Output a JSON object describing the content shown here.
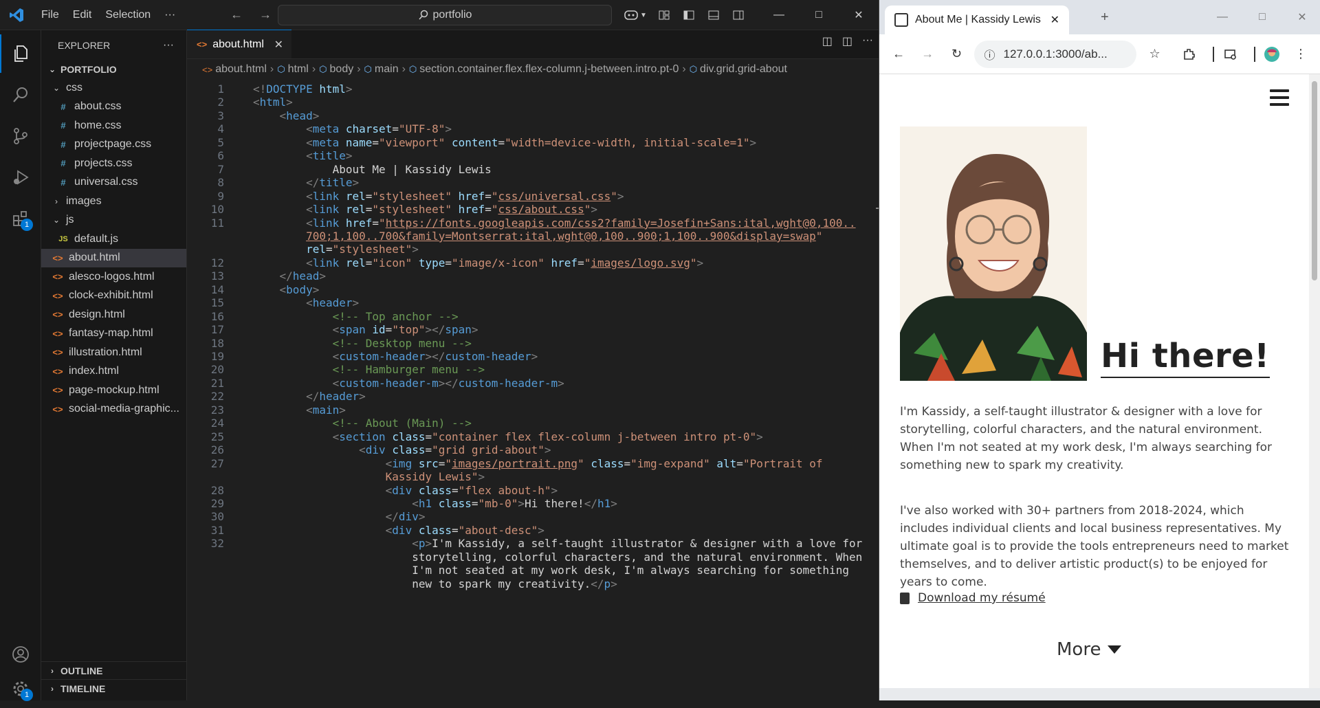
{
  "vscode": {
    "menu": [
      "File",
      "Edit",
      "Selection"
    ],
    "menu_more": "···",
    "command_center": "portfolio",
    "explorer_title": "EXPLORER",
    "explorer_more": "···",
    "root_folder": "PORTFOLIO",
    "tree": [
      {
        "label": "css",
        "kind": "folder",
        "expanded": true,
        "depth": 1
      },
      {
        "label": "about.css",
        "kind": "css",
        "depth": 2
      },
      {
        "label": "home.css",
        "kind": "css",
        "depth": 2
      },
      {
        "label": "projectpage.css",
        "kind": "css",
        "depth": 2
      },
      {
        "label": "projects.css",
        "kind": "css",
        "depth": 2
      },
      {
        "label": "universal.css",
        "kind": "css",
        "depth": 2
      },
      {
        "label": "images",
        "kind": "folder",
        "expanded": false,
        "depth": 1
      },
      {
        "label": "js",
        "kind": "folder",
        "expanded": true,
        "depth": 1
      },
      {
        "label": "default.js",
        "kind": "js",
        "depth": 2
      },
      {
        "label": "about.html",
        "kind": "html",
        "depth": 1,
        "selected": true
      },
      {
        "label": "alesco-logos.html",
        "kind": "html",
        "depth": 1
      },
      {
        "label": "clock-exhibit.html",
        "kind": "html",
        "depth": 1
      },
      {
        "label": "design.html",
        "kind": "html",
        "depth": 1
      },
      {
        "label": "fantasy-map.html",
        "kind": "html",
        "depth": 1
      },
      {
        "label": "illustration.html",
        "kind": "html",
        "depth": 1
      },
      {
        "label": "index.html",
        "kind": "html",
        "depth": 1
      },
      {
        "label": "page-mockup.html",
        "kind": "html",
        "depth": 1
      },
      {
        "label": "social-media-graphic...",
        "kind": "html",
        "depth": 1
      }
    ],
    "outline": "OUTLINE",
    "timeline": "TIMELINE",
    "extensions_badge": "1",
    "settings_badge": "1",
    "active_tab": "about.html",
    "breadcrumbs": [
      "about.html",
      "html",
      "body",
      "main",
      "section.container.flex.flex-column.j-between.intro.pt-0",
      "div.grid.grid-about"
    ],
    "code_lines": [
      {
        "n": "1",
        "html": "<span class='p'>&lt;!</span><span class='t'>DOCTYPE</span> <span class='a'>html</span><span class='p'>&gt;</span>"
      },
      {
        "n": "2",
        "html": "<span class='p'>&lt;</span><span class='t'>html</span><span class='p'>&gt;</span>"
      },
      {
        "n": "3",
        "html": "    <span class='p'>&lt;</span><span class='t'>head</span><span class='p'>&gt;</span>"
      },
      {
        "n": "4",
        "html": "        <span class='p'>&lt;</span><span class='t'>meta</span> <span class='a'>charset</span><span class='x'>=</span><span class='s'>\"UTF-8\"</span><span class='p'>&gt;</span>"
      },
      {
        "n": "5",
        "html": "        <span class='p'>&lt;</span><span class='t'>meta</span> <span class='a'>name</span><span class='x'>=</span><span class='s'>\"viewport\"</span> <span class='a'>content</span><span class='x'>=</span><span class='s'>\"width=device-width, initial-scale=1\"</span><span class='p'>&gt;</span>"
      },
      {
        "n": "6",
        "html": "        <span class='p'>&lt;</span><span class='t'>title</span><span class='p'>&gt;</span>"
      },
      {
        "n": "7",
        "html": "            <span class='x'>About Me | Kassidy Lewis</span>"
      },
      {
        "n": "8",
        "html": "        <span class='p'>&lt;/</span><span class='t'>title</span><span class='p'>&gt;</span>"
      },
      {
        "n": "9",
        "html": "        <span class='p'>&lt;</span><span class='t'>link</span> <span class='a'>rel</span><span class='x'>=</span><span class='s'>\"stylesheet\"</span> <span class='a'>href</span><span class='x'>=</span><span class='s'>\"</span><span class='u'>css/universal.css</span><span class='s'>\"</span><span class='p'>&gt;</span>"
      },
      {
        "n": "10",
        "html": "        <span class='p'>&lt;</span><span class='t'>link</span> <span class='a'>rel</span><span class='x'>=</span><span class='s'>\"stylesheet\"</span> <span class='a'>href</span><span class='x'>=</span><span class='s'>\"</span><span class='u'>css/about.css</span><span class='s'>\"</span><span class='p'>&gt;</span>"
      },
      {
        "n": "11",
        "html": "        <span class='p'>&lt;</span><span class='t'>link</span> <span class='a'>href</span><span class='x'>=</span><span class='s'>\"</span><span class='u'>https://fonts.googleapis.com/css2?family=Josefin+Sans:ital,wght@0,100..</span>"
      },
      {
        "n": "",
        "html": "        <span class='u'>700;1,100..700&amp;family=Montserrat:ital,wght@0,100..900;1,100..900&amp;display=swap</span><span class='s'>\"</span>"
      },
      {
        "n": "",
        "html": "        <span class='a'>rel</span><span class='x'>=</span><span class='s'>\"stylesheet\"</span><span class='p'>&gt;</span>"
      },
      {
        "n": "12",
        "html": "        <span class='p'>&lt;</span><span class='t'>link</span> <span class='a'>rel</span><span class='x'>=</span><span class='s'>\"icon\"</span> <span class='a'>type</span><span class='x'>=</span><span class='s'>\"image/x-icon\"</span> <span class='a'>href</span><span class='x'>=</span><span class='s'>\"</span><span class='u'>images/logo.svg</span><span class='s'>\"</span><span class='p'>&gt;</span>"
      },
      {
        "n": "13",
        "html": "    <span class='p'>&lt;/</span><span class='t'>head</span><span class='p'>&gt;</span>"
      },
      {
        "n": "14",
        "html": "    <span class='p'>&lt;</span><span class='t'>body</span><span class='p'>&gt;</span>"
      },
      {
        "n": "15",
        "html": "        <span class='p'>&lt;</span><span class='t'>header</span><span class='p'>&gt;</span>"
      },
      {
        "n": "16",
        "html": "            <span class='c'>&lt;!-- Top anchor --&gt;</span>"
      },
      {
        "n": "17",
        "html": "            <span class='p'>&lt;</span><span class='t'>span</span> <span class='a'>id</span><span class='x'>=</span><span class='s'>\"top\"</span><span class='p'>&gt;&lt;/</span><span class='t'>span</span><span class='p'>&gt;</span>"
      },
      {
        "n": "18",
        "html": "            <span class='c'>&lt;!-- Desktop menu --&gt;</span>"
      },
      {
        "n": "19",
        "html": "            <span class='p'>&lt;</span><span class='t'>custom-header</span><span class='p'>&gt;&lt;/</span><span class='t'>custom-header</span><span class='p'>&gt;</span>"
      },
      {
        "n": "20",
        "html": "            <span class='c'>&lt;!-- Hamburger menu --&gt;</span>"
      },
      {
        "n": "21",
        "html": "            <span class='p'>&lt;</span><span class='t'>custom-header-m</span><span class='p'>&gt;&lt;/</span><span class='t'>custom-header-m</span><span class='p'>&gt;</span>"
      },
      {
        "n": "22",
        "html": "        <span class='p'>&lt;/</span><span class='t'>header</span><span class='p'>&gt;</span>"
      },
      {
        "n": "23",
        "html": "        <span class='p'>&lt;</span><span class='t'>main</span><span class='p'>&gt;</span>"
      },
      {
        "n": "24",
        "html": "            <span class='c'>&lt;!-- About (Main) --&gt;</span>"
      },
      {
        "n": "25",
        "html": "            <span class='p'>&lt;</span><span class='t'>section</span> <span class='a'>class</span><span class='x'>=</span><span class='s'>\"container flex flex-column j-between intro pt-0\"</span><span class='p'>&gt;</span>"
      },
      {
        "n": "26",
        "html": "                <span class='p'>&lt;</span><span class='t'>div</span> <span class='a'>class</span><span class='x'>=</span><span class='s'>\"grid grid-about\"</span><span class='p'>&gt;</span>"
      },
      {
        "n": "27",
        "html": "                    <span class='p'>&lt;</span><span class='t'>img</span> <span class='a'>src</span><span class='x'>=</span><span class='s'>\"</span><span class='u'>images/portrait.png</span><span class='s'>\"</span> <span class='a'>class</span><span class='x'>=</span><span class='s'>\"img-expand\"</span> <span class='a'>alt</span><span class='x'>=</span><span class='s'>\"Portrait of</span>"
      },
      {
        "n": "",
        "html": "                    <span class='s'>Kassidy Lewis\"</span><span class='p'>&gt;</span>"
      },
      {
        "n": "28",
        "html": "                    <span class='p'>&lt;</span><span class='t'>div</span> <span class='a'>class</span><span class='x'>=</span><span class='s'>\"flex about-h\"</span><span class='p'>&gt;</span>"
      },
      {
        "n": "29",
        "html": "                        <span class='p'>&lt;</span><span class='t'>h1</span> <span class='a'>class</span><span class='x'>=</span><span class='s'>\"mb-0\"</span><span class='p'>&gt;</span><span class='x'>Hi there!</span><span class='p'>&lt;/</span><span class='t'>h1</span><span class='p'>&gt;</span>"
      },
      {
        "n": "30",
        "html": "                    <span class='p'>&lt;/</span><span class='t'>div</span><span class='p'>&gt;</span>"
      },
      {
        "n": "31",
        "html": "                    <span class='p'>&lt;</span><span class='t'>div</span> <span class='a'>class</span><span class='x'>=</span><span class='s'>\"about-desc\"</span><span class='p'>&gt;</span>"
      },
      {
        "n": "32",
        "html": "                        <span class='p'>&lt;</span><span class='t'>p</span><span class='p'>&gt;</span><span class='x'>I'm Kassidy, a self-taught illustrator &amp; designer with a love for</span>"
      },
      {
        "n": "",
        "html": "                        <span class='x'>storytelling, colorful characters, and the natural environment. When</span>"
      },
      {
        "n": "",
        "html": "                        <span class='x'>I'm not seated at my work desk, I'm always searching for something</span>"
      },
      {
        "n": "",
        "html": "                        <span class='x'>new to spark my creativity.</span><span class='p'>&lt;/</span><span class='t'>p</span><span class='p'>&gt;</span>"
      }
    ]
  },
  "browser": {
    "tab_title": "About Me | Kassidy Lewis",
    "new_tab": "+",
    "url": "127.0.0.1:3000/ab...",
    "page": {
      "heading": "Hi there!",
      "para1": "I'm Kassidy, a self-taught illustrator & designer with a love for storytelling, colorful characters, and the natural environment. When I'm not seated at my work desk, I'm always searching for something new to spark my creativity.",
      "para2": "I've also worked with 30+ partners from 2018-2024, which includes individual clients and local business representatives. My ultimate goal is to provide the tools entrepreneurs need to market themselves, and to deliver artistic product(s) to be enjoyed for years to come.",
      "download_link": "Download my résumé",
      "more_label": "More"
    }
  },
  "colors": {
    "vscode_bg": "#1f1f1f",
    "accent": "#0078d4",
    "css_icon": "#519aba",
    "html_icon": "#e37933",
    "js_icon": "#cbcb41"
  }
}
